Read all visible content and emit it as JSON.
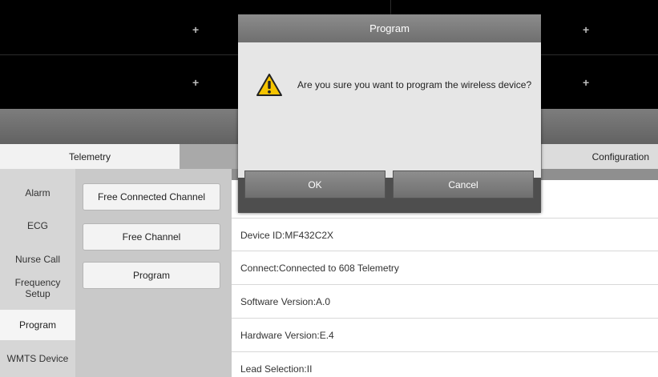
{
  "monitor": {
    "plus_glyph": "+"
  },
  "tabs": {
    "telemetry": "Telemetry",
    "configuration": "Configuration"
  },
  "left_menu": {
    "items": [
      "Alarm",
      "ECG",
      "Nurse Call",
      "Frequency\nSetup",
      "Program",
      "WMTS Device"
    ],
    "selected": "Program"
  },
  "buttons": {
    "free_connected_channel": "Free Connected Channel",
    "free_channel": "Free Channel",
    "program": "Program"
  },
  "info": {
    "device_id": "Device ID:MF432C2X",
    "connect": "Connect:Connected to 608 Telemetry",
    "software_version": "Software Version:A.0",
    "hardware_version": "Hardware Version:E.4",
    "lead_selection": "Lead Selection:II"
  },
  "dialog": {
    "title": "Program",
    "message": "Are you sure you want to program the wireless device?",
    "ok_label": "OK",
    "cancel_label": "Cancel",
    "icon": "warning-icon"
  },
  "colors": {
    "warning_fill": "#f5c400",
    "dialog_body": "#e6e6e6",
    "title_bar": "#7a7a7a"
  }
}
